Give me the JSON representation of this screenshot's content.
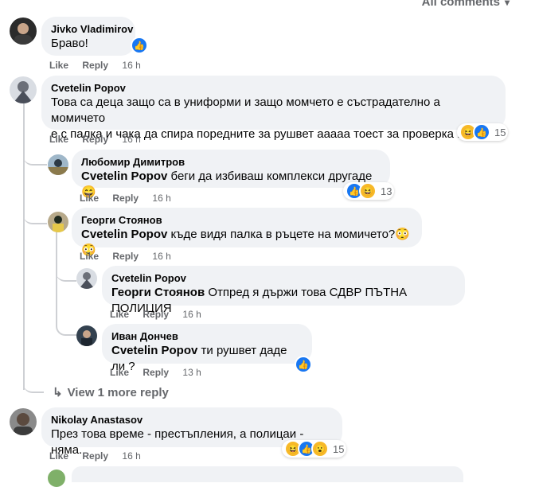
{
  "header": {
    "all_comments": "All comments"
  },
  "comments": [
    {
      "author": "Jivko Vladimirov",
      "text": "Браво!",
      "like": "Like",
      "reply": "Reply",
      "time": "16 h"
    },
    {
      "author": "Cvetelin Popov",
      "line1": "Това са деца защо са в униформи и защо момчето е състрадателно а момичето",
      "line2": "е с палка и чака да спира поредните за рушвет ааааа тоест за проверка !",
      "like": "Like",
      "reply": "Reply",
      "time": "16 h",
      "reactions": "15"
    },
    {
      "author": "Любомир Димитров",
      "mention": "Cvetelin Popov",
      "text": " беги да избиваш комплекси другаде 😄",
      "like": "Like",
      "reply": "Reply",
      "time": "16 h",
      "reactions": "13"
    },
    {
      "author": "Георги Стоянов",
      "mention": "Cvetelin Popov",
      "text": " къде видя палка в ръцете на момичето?😳😳",
      "like": "Like",
      "reply": "Reply",
      "time": "16 h"
    },
    {
      "author": "Cvetelin Popov",
      "mention": "Георги Стоянов",
      "text": " Отпред я държи това СДВР ПЪТНА ПОЛИЦИЯ",
      "like": "Like",
      "reply": "Reply",
      "time": "16 h"
    },
    {
      "author": "Иван Дончев",
      "mention": "Cvetelin Popov",
      "text": " ти рушвет даде ли ?",
      "like": "Like",
      "reply": "Reply",
      "time": "13 h"
    },
    {
      "author": "Nikolay Anastasov",
      "text": "През това време - престъпления, а полицаи - няма.",
      "like": "Like",
      "reply": "Reply",
      "time": "16 h",
      "reactions": "15"
    }
  ],
  "view_more": "View 1 more reply",
  "icons": {
    "like": "like-reaction-icon",
    "haha": "haha-reaction-icon",
    "wow": "wow-reaction-icon",
    "reply_arrow": "reply-arrow-icon"
  },
  "colors": {
    "bubble": "#f0f2f5",
    "like_blue": "#1877f2",
    "emoji_yellow": "#f7b928",
    "meta_gray": "#65676b"
  }
}
